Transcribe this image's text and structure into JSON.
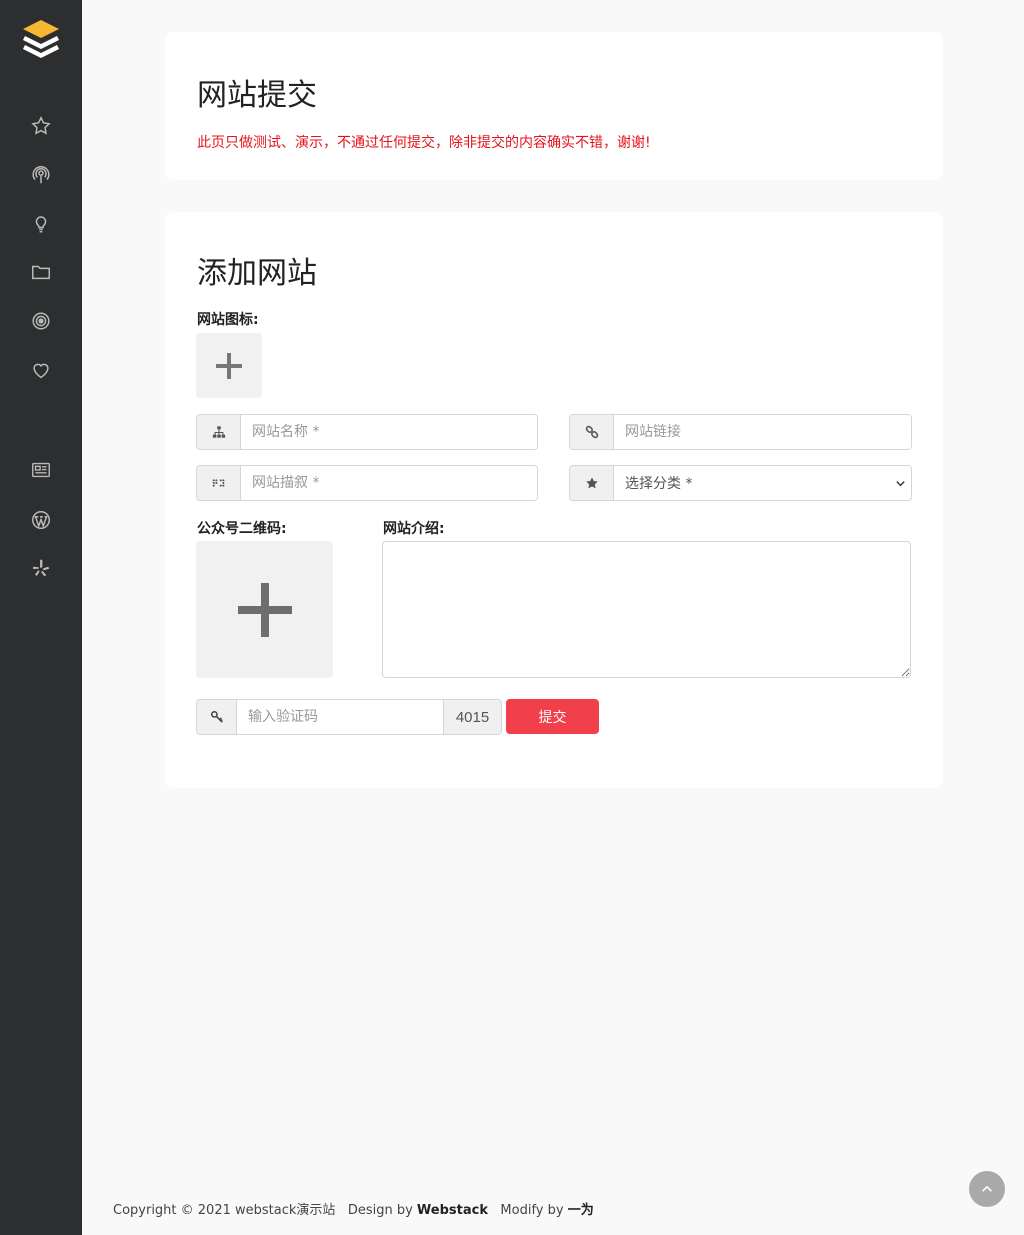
{
  "sidebar": {
    "logo": "layers-logo",
    "items": [
      {
        "icon": "star-icon"
      },
      {
        "icon": "podcast-icon"
      },
      {
        "icon": "lightbulb-icon"
      },
      {
        "icon": "folder-icon"
      },
      {
        "icon": "target-icon"
      },
      {
        "icon": "heart-icon"
      },
      {
        "icon": "newspaper-icon"
      },
      {
        "icon": "wordpress-icon"
      },
      {
        "icon": "yelp-icon"
      }
    ]
  },
  "notice_card": {
    "title": "网站提交",
    "notice": "此页只做测试、演示，不通过任何提交，除非提交的内容确实不错，谢谢!"
  },
  "form": {
    "title": "添加网站",
    "icon_label": "网站图标:",
    "site_name_placeholder": "网站名称 *",
    "site_link_placeholder": "网站链接",
    "site_desc_placeholder": "网站描叙 *",
    "category_value": "选择分类 *",
    "qrcode_label": "公众号二维码:",
    "intro_label": "网站介绍:",
    "captcha_placeholder": "输入验证码",
    "captcha_code": "4015",
    "submit_label": "提交"
  },
  "footer": {
    "copyright": "Copyright © 2021 webstack演示站",
    "design_prefix": "Design by",
    "design_name": "Webstack",
    "modify_prefix": "Modify by",
    "modify_name": "一为"
  },
  "colors": {
    "sidebar_bg": "#2c2e2f",
    "accent": "#f1404b",
    "notice": "#e5141b"
  }
}
